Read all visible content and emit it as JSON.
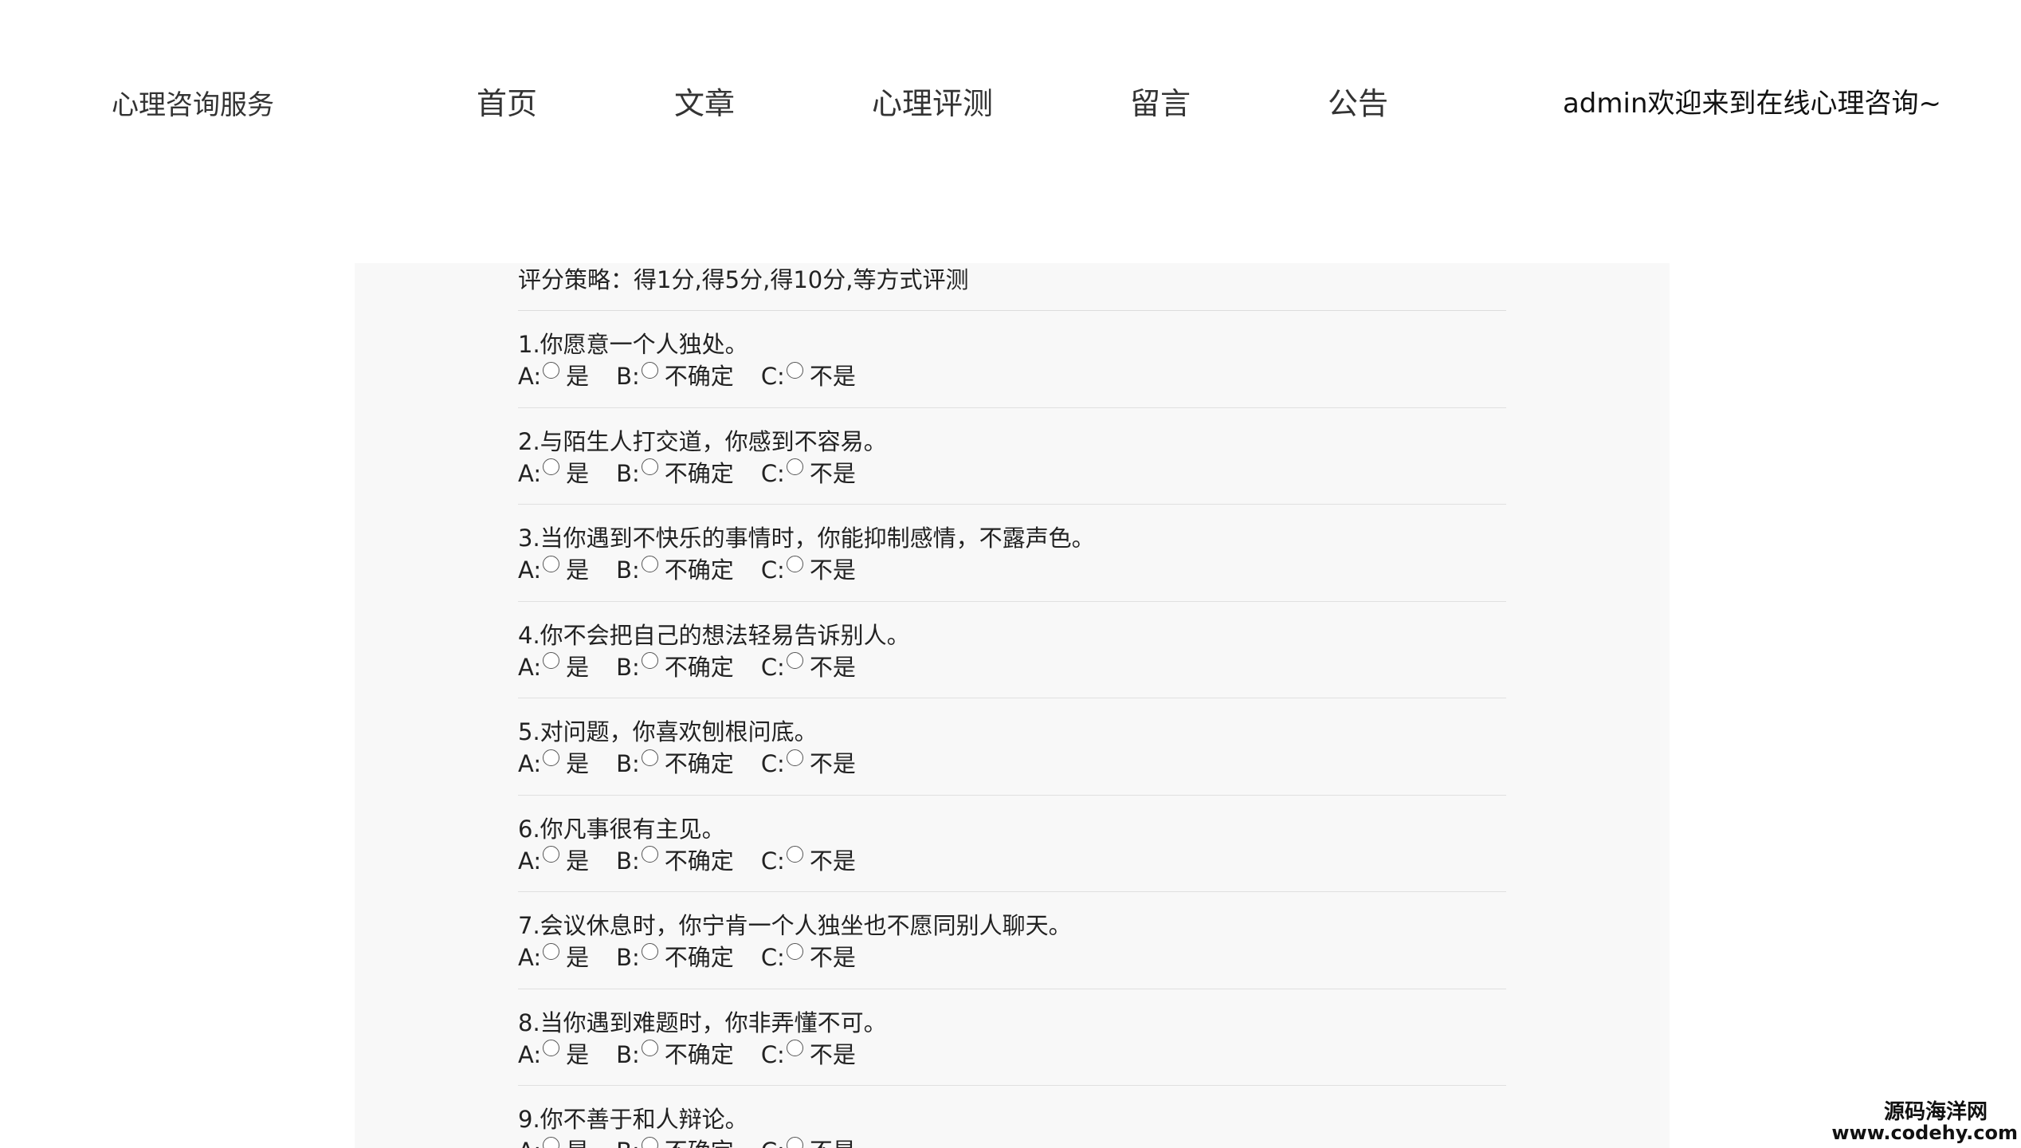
{
  "header": {
    "logo": "心理咨询服务",
    "nav": [
      "首页",
      "文章",
      "心理评测",
      "留言",
      "公告"
    ],
    "welcome": "admin欢迎来到在线心理咨询~"
  },
  "survey": {
    "scoring": "评分策略：得1分,得5分,得10分,等方式评测",
    "option_letters": [
      "A:",
      "B:",
      "C:"
    ],
    "option_texts": [
      "是",
      "不确定",
      "不是"
    ],
    "questions": [
      "1.你愿意一个人独处。",
      "2.与陌生人打交道，你感到不容易。",
      "3.当你遇到不快乐的事情时，你能抑制感情，不露声色。",
      "4.你不会把自己的想法轻易告诉别人。",
      "5.对问题，你喜欢刨根问底。",
      "6.你凡事很有主见。",
      "7.会议休息时，你宁肯一个人独坐也不愿同别人聊天。",
      "8.当你遇到难题时，你非弄懂不可。",
      "9.你不善于和人辩论。"
    ]
  },
  "watermark": {
    "line1": "源码海洋网",
    "line2": "www.codehy.com"
  }
}
